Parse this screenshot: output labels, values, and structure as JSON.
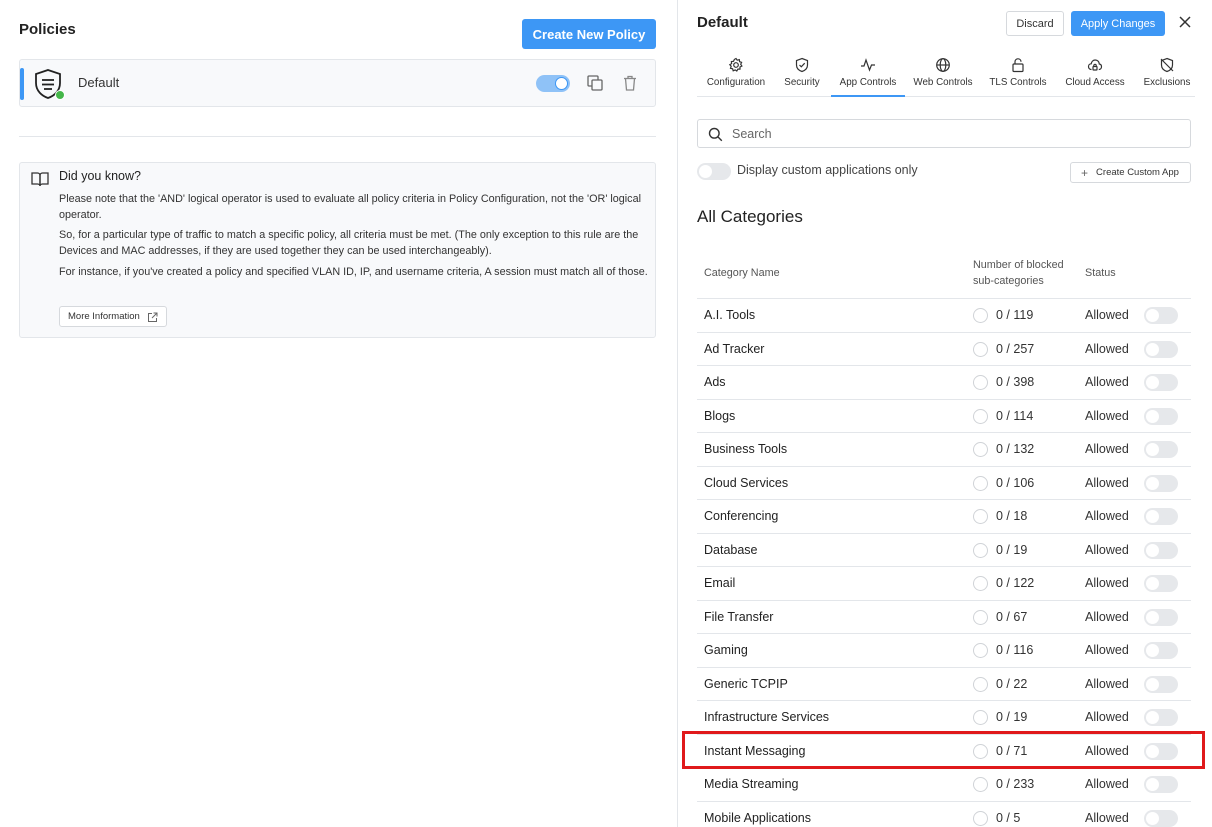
{
  "left": {
    "title": "Policies",
    "create_button": "Create New Policy",
    "policy": {
      "name": "Default",
      "enabled": true
    },
    "info": {
      "heading": "Did you know?",
      "paragraphs": [
        "Please note that the 'AND' logical operator is used to evaluate all policy criteria in Policy Configuration, not the 'OR' logical operator.",
        "So, for a particular type of traffic to match a specific policy, all criteria must be met. (The only exception to this rule are the Devices and MAC addresses, if they are used together they can be used interchangeably).",
        "For instance, if you've created a policy and specified VLAN ID, IP, and username criteria, A session must match all of those."
      ],
      "more_button": "More Information"
    }
  },
  "right": {
    "title": "Default",
    "discard_button": "Discard",
    "apply_button": "Apply Changes",
    "tabs": [
      {
        "label": "Configuration",
        "icon": "gear-icon"
      },
      {
        "label": "Security",
        "icon": "shield-check-icon"
      },
      {
        "label": "App Controls",
        "icon": "activity-icon",
        "active": true
      },
      {
        "label": "Web Controls",
        "icon": "globe-icon"
      },
      {
        "label": "TLS Controls",
        "icon": "lock-icon"
      },
      {
        "label": "Cloud Access",
        "icon": "cloud-lock-icon"
      },
      {
        "label": "Exclusions",
        "icon": "shield-off-icon"
      }
    ],
    "search_placeholder": "Search",
    "custom_only_label": "Display custom applications only",
    "create_custom_button": "Create Custom App",
    "section_title": "All Categories",
    "columns": {
      "name": "Category Name",
      "blocked_line1": "Number of blocked",
      "blocked_line2": "sub-categories",
      "status": "Status"
    },
    "rows": [
      {
        "name": "A.I. Tools",
        "count": "0 / 119",
        "status": "Allowed"
      },
      {
        "name": "Ad Tracker",
        "count": "0 / 257",
        "status": "Allowed"
      },
      {
        "name": "Ads",
        "count": "0 / 398",
        "status": "Allowed"
      },
      {
        "name": "Blogs",
        "count": "0 / 114",
        "status": "Allowed"
      },
      {
        "name": "Business Tools",
        "count": "0 / 132",
        "status": "Allowed"
      },
      {
        "name": "Cloud Services",
        "count": "0 / 106",
        "status": "Allowed"
      },
      {
        "name": "Conferencing",
        "count": "0 / 18",
        "status": "Allowed"
      },
      {
        "name": "Database",
        "count": "0 / 19",
        "status": "Allowed"
      },
      {
        "name": "Email",
        "count": "0 / 122",
        "status": "Allowed"
      },
      {
        "name": "File Transfer",
        "count": "0 / 67",
        "status": "Allowed"
      },
      {
        "name": "Gaming",
        "count": "0 / 116",
        "status": "Allowed"
      },
      {
        "name": "Generic TCPIP",
        "count": "0 / 22",
        "status": "Allowed"
      },
      {
        "name": "Infrastructure Services",
        "count": "0 / 19",
        "status": "Allowed"
      },
      {
        "name": "Instant Messaging",
        "count": "0 / 71",
        "status": "Allowed"
      },
      {
        "name": "Media Streaming",
        "count": "0 / 233",
        "status": "Allowed"
      },
      {
        "name": "Mobile Applications",
        "count": "0 / 5",
        "status": "Allowed"
      }
    ],
    "highlighted_row": "Instant Messaging"
  },
  "colors": {
    "accent": "#3d97f5",
    "status_green": "#44b649",
    "highlight_red": "#e0191b"
  }
}
